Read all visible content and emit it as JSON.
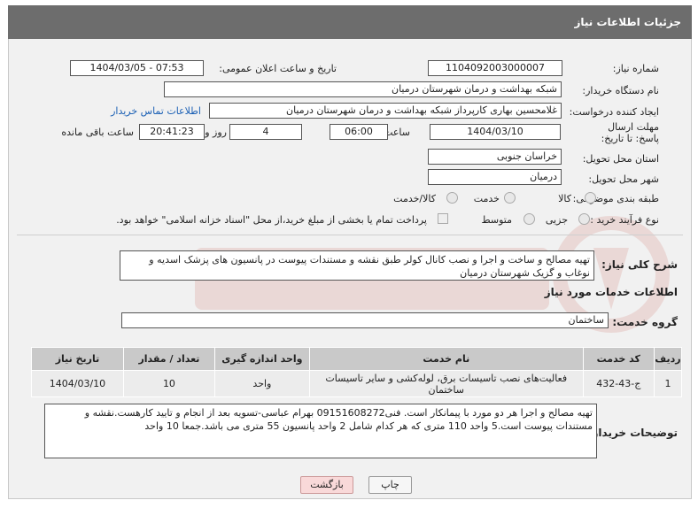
{
  "header": {
    "title": "جزئیات اطلاعات نیاز"
  },
  "fields": {
    "need_number_label": "شماره نیاز:",
    "need_number": "1104092003000007",
    "announce_label": "تاریخ و ساعت اعلان عمومی:",
    "announce_value": "1404/03/05 - 07:53",
    "buyer_org_label": "نام دستگاه خریدار:",
    "buyer_org": "شبکه بهداشت و درمان شهرستان درمیان",
    "creator_label": "ایجاد کننده درخواست:",
    "creator": "غلامحسین بهاری کارپرداز شبکه بهداشت و درمان شهرستان درمیان",
    "contact_link": "اطلاعات تماس خریدار",
    "deadline_label": "مهلت ارسال پاسخ: تا تاریخ:",
    "deadline_date": "1404/03/10",
    "time_label": "ساعت",
    "deadline_time": "06:00",
    "days_value": "4",
    "days_label": "روز و",
    "remaining_time": "20:41:23",
    "remaining_label": "ساعت باقی مانده",
    "province_label": "استان محل تحویل:",
    "province": "خراسان جنوبی",
    "city_label": "شهر محل تحویل:",
    "city": "درمیان",
    "category_label": "طبقه بندی موضوعی:",
    "category_options": [
      "کالا",
      "خدمت",
      "کالا/خدمت"
    ],
    "process_label": "نوع فرآیند خرید :",
    "process_options": [
      "جزیی",
      "متوسط"
    ],
    "payment_note": "پرداخت تمام یا بخشی از مبلغ خرید،از محل \"اسناد خزانه اسلامی\" خواهد بود."
  },
  "description": {
    "label": "شرح کلی نیاز:",
    "text": "تهیه مصالح و ساخت و اجرا و نصب کانال کولر طبق نقشه و مستندات پیوست در پانسیون های پزشک اسدیه و نوغاب و گزیک شهرستان درمیان"
  },
  "services": {
    "section_title": "اطلاعات خدمات مورد نیاز",
    "group_label": "گروه خدمت:",
    "group_value": "ساختمان",
    "columns": [
      "ردیف",
      "کد خدمت",
      "نام خدمت",
      "واحد اندازه گیری",
      "تعداد / مقدار",
      "تاریخ نیاز"
    ],
    "rows": [
      [
        "1",
        "ج-43-432",
        "فعالیت‌های نصب تاسیسات برق، لوله‌کشی و سایر تاسیسات ساختمان",
        "واحد",
        "10",
        "1404/03/10"
      ]
    ]
  },
  "buyer_notes": {
    "label": "توضیحات خریدار:",
    "text": "تهیه مصالح و اجرا هر دو مورد با پیمانکار است. فنی09151608272 بهرام عباسی-تسویه بعد از انجام و تایید کارهست.نقشه و مستندات پیوست است.5 واحد 110 متری که هر کدام شامل 2 واحد پانسیون 55 متری می باشد.جمعا 10 واحد"
  },
  "buttons": {
    "print": "چاپ",
    "back": "بازگشت"
  },
  "colors": {
    "header_bg": "#6d6d6d",
    "link": "#1a5fb4",
    "back_button_bg": "#f9d9d9"
  }
}
